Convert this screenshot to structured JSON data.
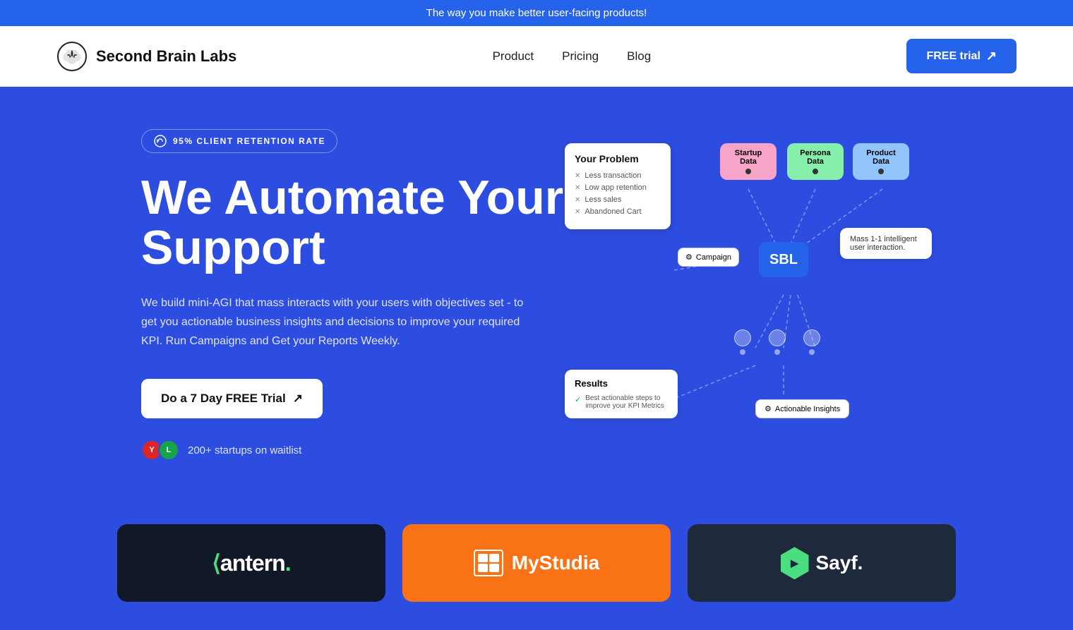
{
  "banner": {
    "text": "The way you make better user-facing products!"
  },
  "navbar": {
    "logo_text": "Second Brain Labs",
    "nav_links": [
      {
        "label": "Product",
        "id": "product"
      },
      {
        "label": "Pricing",
        "id": "pricing"
      },
      {
        "label": "Blog",
        "id": "blog"
      }
    ],
    "cta_label": "FREE trial"
  },
  "hero": {
    "badge_text": "95% CLIENT RETENTION RATE",
    "title_line1": "We Automate Your",
    "title_line2": "Support",
    "description": "We build mini-AGI that mass interacts with your users with objectives set - to get you actionable business insights and decisions to improve your required KPI. Run Campaigns and Get your Reports Weekly.",
    "trial_button": "Do a 7 Day FREE Trial",
    "waitlist_text": "200+ startups on waitlist"
  },
  "diagram": {
    "your_problem_title": "Your Problem",
    "problem_items": [
      "Less transaction",
      "Low app retention",
      "Less sales",
      "Abandoned Cart"
    ],
    "startup_label": "Startup\nData",
    "persona_label": "Persona\nData",
    "product_label": "Product\nData",
    "sbl_label": "SBL",
    "campaign_label": "Campaign",
    "mass_interaction_text": "Mass 1-1 intelligent user interaction.",
    "results_title": "Results",
    "results_item": "Best actionable steps to improve your KPI Metrics",
    "actionable_label": "Actionable Insights"
  },
  "logos": [
    {
      "name": "antern",
      "text": "antern.",
      "bg": "dark"
    },
    {
      "name": "mystudia",
      "text": "MyStudia",
      "bg": "orange"
    },
    {
      "name": "sayf",
      "text": "Sayf.",
      "bg": "navy"
    }
  ]
}
